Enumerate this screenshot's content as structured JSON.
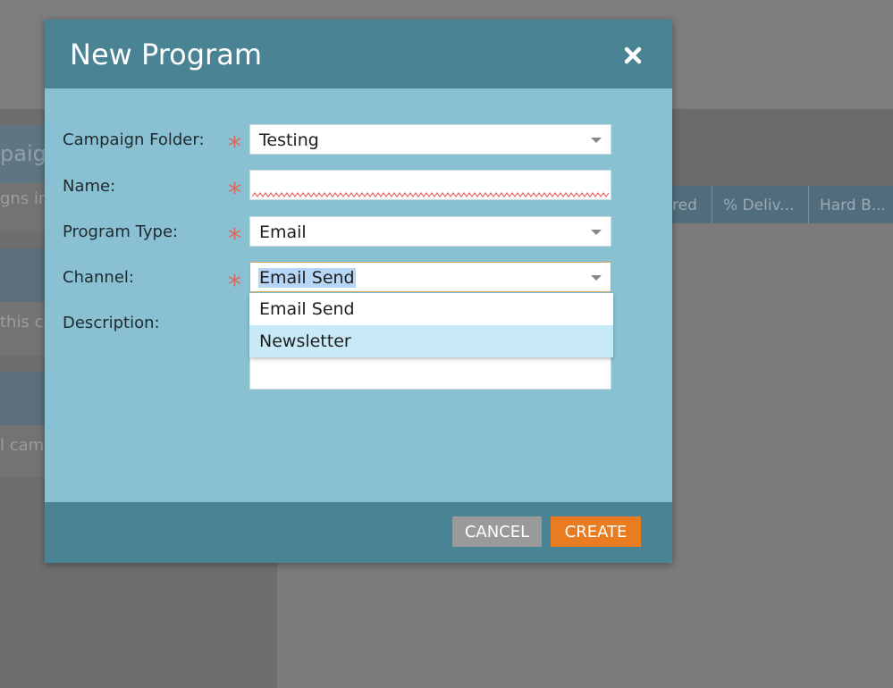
{
  "background": {
    "left_panel_texts": [
      "paign",
      "gns in",
      "this ca",
      "l camp"
    ],
    "columns": [
      "red",
      "% Deliv...",
      "Hard B..."
    ]
  },
  "dialog": {
    "title": "New Program",
    "fields": {
      "campaign_folder": {
        "label": "Campaign Folder:",
        "value": "Testing"
      },
      "name": {
        "label": "Name:",
        "value": ""
      },
      "program_type": {
        "label": "Program Type:",
        "value": "Email"
      },
      "channel": {
        "label": "Channel:",
        "value": "Email Send"
      },
      "description": {
        "label": "Description:",
        "value": ""
      }
    },
    "required_mark": "*",
    "channel_options": [
      "Email Send",
      "Newsletter"
    ],
    "buttons": {
      "cancel": "CANCEL",
      "create": "CREATE"
    }
  },
  "colors": {
    "header": "#4a8394",
    "body": "#89c1d2",
    "create": "#e97c21",
    "cancel": "#9a9a9a",
    "required": "#d86a5c"
  }
}
